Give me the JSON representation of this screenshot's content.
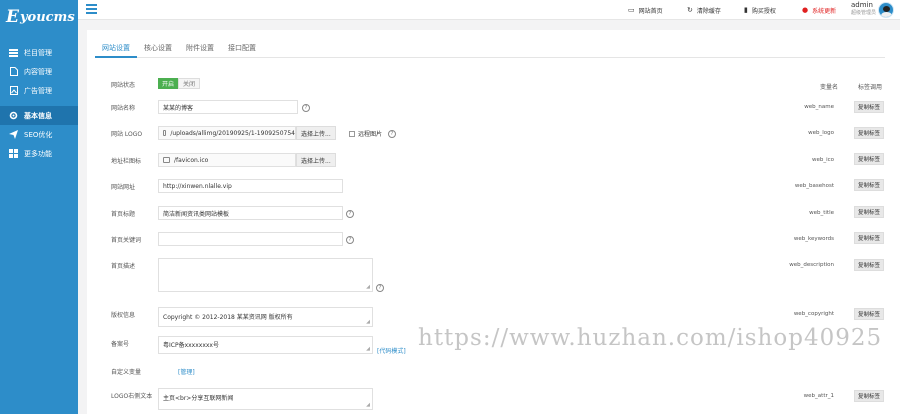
{
  "brand": {
    "logo_big": "E",
    "logo_rest": "youcms"
  },
  "sidebar": {
    "items": [
      {
        "label": "栏目管理",
        "icon": "list-icon"
      },
      {
        "label": "内容管理",
        "icon": "document-icon"
      },
      {
        "label": "广告管理",
        "icon": "image-icon"
      },
      {
        "label": "基本信息",
        "icon": "gear-icon"
      },
      {
        "label": "SEO优化",
        "icon": "send-icon"
      },
      {
        "label": "更多功能",
        "icon": "grid-icon"
      }
    ]
  },
  "topbar": {
    "links": [
      {
        "label": "网站首页",
        "icon": "monitor-icon"
      },
      {
        "label": "清除缓存",
        "icon": "refresh-icon"
      },
      {
        "label": "购买授权",
        "icon": "bookmark-icon"
      },
      {
        "label": "系统更新",
        "icon": "alert-icon"
      }
    ],
    "admin": "admin",
    "role": "超级管理员"
  },
  "tabs": [
    "网站设置",
    "核心设置",
    "附件设置",
    "接口配置"
  ],
  "columns": {
    "var": "变量名",
    "call": "标签调用"
  },
  "fields": {
    "status": {
      "label": "网站状态",
      "on": "开启",
      "off": "关闭"
    },
    "name": {
      "label": "网站名称",
      "value": "某某的博客",
      "var": "web_name",
      "call": "复制标签"
    },
    "logo": {
      "label": "网站 LOGO",
      "value": "/uploads/allimg/20190925/1-1909250754",
      "btn": "选择上传...",
      "check": "远程图片",
      "var": "web_logo",
      "call": "复制标签"
    },
    "ico": {
      "label": "地址栏图标",
      "value": "/favicon.ico",
      "btn": "选择上传...",
      "var": "web_ico",
      "call": "复制标签"
    },
    "url": {
      "label": "网站网址",
      "value": "http://xinwen.nlalle.vip",
      "var": "web_basehost",
      "call": "复制标签"
    },
    "title": {
      "label": "首页标题",
      "value": "简洁新闻资讯类网站模板",
      "var": "web_title",
      "call": "复制标签"
    },
    "keywords": {
      "label": "首页关键词",
      "value": "",
      "var": "web_keywords",
      "call": "复制标签"
    },
    "desc": {
      "label": "首页描述",
      "value": "",
      "var": "web_description",
      "call": "复制标签"
    },
    "copyright": {
      "label": "版权信息",
      "value": "Copyright © 2012-2018 某某资讯网 版权所有",
      "var": "web_copyright",
      "call": "复制标签"
    },
    "beian": {
      "label": "备案号",
      "value": "粤ICP备xxxxxxxx号",
      "link": "[代码模式]"
    },
    "custom": {
      "label": "自定义变量",
      "link": "[管理]"
    },
    "slogan": {
      "label": "LOGO右侧文本",
      "value": "主页<br>分享互联网新闻",
      "var": "web_attr_1",
      "call": "复制标签"
    }
  },
  "watermark": "https://www.huzhan.com/ishop40925"
}
